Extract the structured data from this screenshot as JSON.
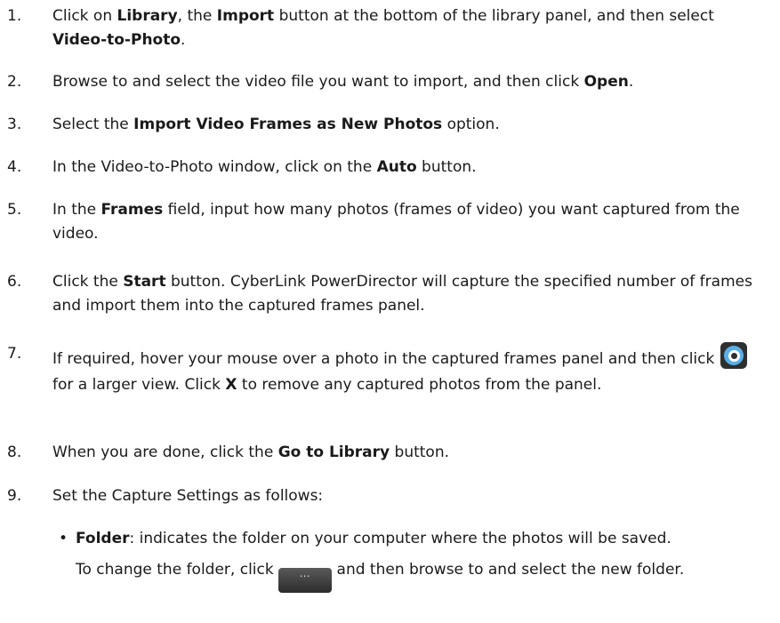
{
  "steps": [
    {
      "num": "1.",
      "parts": [
        {
          "t": "Click on "
        },
        {
          "b": "Library"
        },
        {
          "t": ", the "
        },
        {
          "b": "Import"
        },
        {
          "t": " button at the bottom of the library panel, and then select "
        },
        {
          "b": "Video-to-Photo"
        },
        {
          "t": "."
        }
      ]
    },
    {
      "num": "2.",
      "parts": [
        {
          "t": "Browse to and select the video file you want to import, and then click "
        },
        {
          "b": "Open"
        },
        {
          "t": "."
        }
      ]
    },
    {
      "num": "3.",
      "parts": [
        {
          "t": "Select the "
        },
        {
          "b": "Import Video Frames as New Photos"
        },
        {
          "t": " option."
        }
      ]
    },
    {
      "num": "4.",
      "parts": [
        {
          "t": "In the Video-to-Photo window, click on the "
        },
        {
          "b": "Auto"
        },
        {
          "t": " button."
        }
      ]
    },
    {
      "num": "5.",
      "parts": [
        {
          "t": "In the "
        },
        {
          "b": "Frames"
        },
        {
          "t": " field, input how many photos (frames of video) you want captured from the video."
        }
      ]
    },
    {
      "num": "6.",
      "parts": [
        {
          "t": "Click the "
        },
        {
          "b": "Start"
        },
        {
          "t": " button. CyberLink PowerDirector will capture the specified number of frames and import them into the captured frames panel."
        }
      ]
    },
    {
      "num": "7.",
      "parts": [
        {
          "t": "If required, hover your mouse over a photo in the captured frames panel and then click "
        },
        {
          "icon": "zoom-view-icon"
        },
        {
          "t": " for a larger view. Click "
        },
        {
          "b": "X"
        },
        {
          "t": " to remove any captured photos from the panel."
        }
      ]
    },
    {
      "num": "8.",
      "parts": [
        {
          "t": "When you are done, click the "
        },
        {
          "b": "Go to Library"
        },
        {
          "t": " button."
        }
      ]
    },
    {
      "num": "9.",
      "parts": [
        {
          "t": "Set the Capture Settings as follows:"
        }
      ]
    }
  ],
  "bullets": [
    {
      "bullet": "•",
      "parts": [
        {
          "b": "Folder"
        },
        {
          "t": ": indicates the folder on your computer where the photos will be saved."
        },
        {
          "br": true
        },
        {
          "t": "To change the folder, click "
        },
        {
          "icon": "more-options-icon",
          "label": "⋯"
        },
        {
          "t": " and then browse to and select the new folder."
        }
      ]
    }
  ]
}
